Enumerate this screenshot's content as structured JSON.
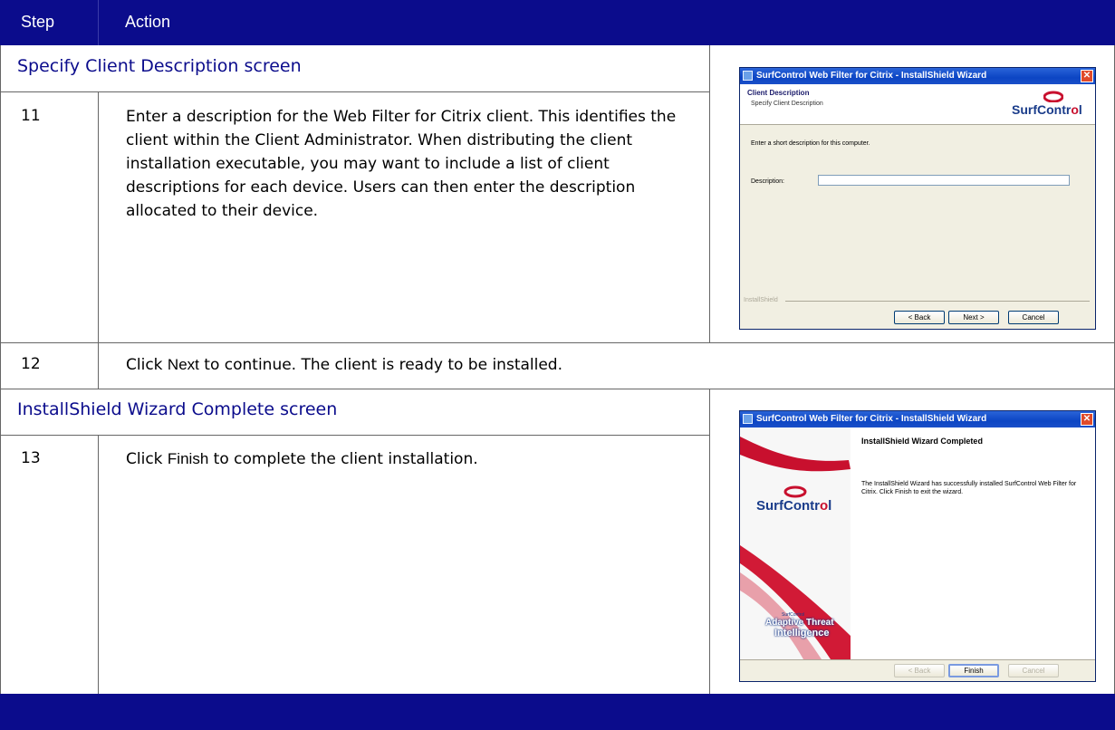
{
  "header": {
    "step": "Step",
    "action": "Action"
  },
  "sections": [
    {
      "title": "Specify Client Description screen"
    },
    {
      "title": "InstallShield Wizard Complete screen"
    }
  ],
  "rows": [
    {
      "step": "11",
      "text": "Enter a description for the Web Filter for Citrix client. This identifies the client within the Client Administrator. When distributing the client installation executable, you may want to include a list of client descriptions for each device. Users can then enter the description allocated to their device."
    },
    {
      "step": "12",
      "text_pre": "Click ",
      "text_bold": "Next",
      "text_post": " to continue. The client is ready to be installed."
    },
    {
      "step": "13",
      "text_pre": "Click ",
      "text_bold": "Finish",
      "text_post": " to complete the client installation."
    }
  ],
  "wizard1": {
    "title": "SurfControl Web Filter for Citrix - InstallShield Wizard",
    "heading": "Client Description",
    "subheading": "Specify Client Description",
    "brand": "SurfContr",
    "brand_o": "o",
    "brand_end": "l",
    "prompt": "Enter a short description for this computer.",
    "field_label": "Description:",
    "field_value": "",
    "installshield": "InstallShield",
    "back": "< Back",
    "next": "Next >",
    "cancel": "Cancel"
  },
  "wizard2": {
    "title": "SurfControl Web Filter for Citrix - InstallShield Wizard",
    "heading": "InstallShield Wizard Completed",
    "message": "The InstallShield Wizard has successfully installed SurfControl Web Filter for Citrix. Click Finish to exit the wizard.",
    "brand": "SurfContr",
    "brand_o": "o",
    "brand_end": "l",
    "ati_small": "SurfControl",
    "ati_line1": "Adaptive Threat",
    "ati_line2": "Intelligence",
    "back": "< Back",
    "finish": "Finish",
    "cancel": "Cancel"
  }
}
